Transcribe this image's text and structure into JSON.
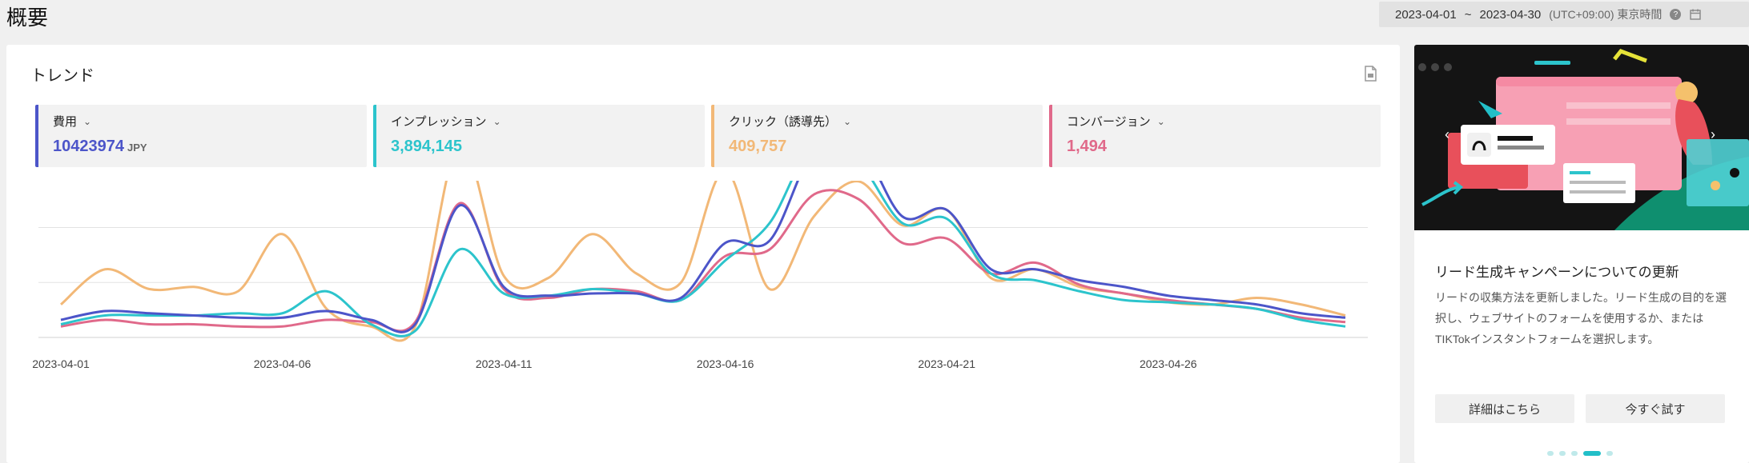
{
  "page": {
    "title": "概要"
  },
  "date_range": {
    "start": "2023-04-01",
    "separator": "~",
    "end": "2023-04-30",
    "timezone": "(UTC+09:00) 東京時間"
  },
  "trend": {
    "title": "トレンド",
    "metrics": [
      {
        "label": "費用",
        "value": "10423974",
        "unit": "JPY",
        "color": "#4c55c9"
      },
      {
        "label": "インプレッション",
        "value": "3,894,145",
        "unit": "",
        "color": "#2cc4cc"
      },
      {
        "label": "クリック（誘導先）",
        "value": "409,757",
        "unit": "",
        "color": "#f2b877"
      },
      {
        "label": "コンバージョン",
        "value": "1,494",
        "unit": "",
        "color": "#e0698a"
      }
    ]
  },
  "chart_data": {
    "type": "line",
    "x": [
      "2023-04-01",
      "2023-04-02",
      "2023-04-03",
      "2023-04-04",
      "2023-04-05",
      "2023-04-06",
      "2023-04-07",
      "2023-04-08",
      "2023-04-09",
      "2023-04-10",
      "2023-04-11",
      "2023-04-12",
      "2023-04-13",
      "2023-04-14",
      "2023-04-15",
      "2023-04-16",
      "2023-04-17",
      "2023-04-18",
      "2023-04-19",
      "2023-04-20",
      "2023-04-21",
      "2023-04-22",
      "2023-04-23",
      "2023-04-24",
      "2023-04-25",
      "2023-04-26",
      "2023-04-27",
      "2023-04-28",
      "2023-04-29",
      "2023-04-30"
    ],
    "x_tick_labels": [
      "2023-04-01",
      "2023-04-06",
      "2023-04-11",
      "2023-04-16",
      "2023-04-21",
      "2023-04-26"
    ],
    "ylim": [
      0,
      100
    ],
    "grid": true,
    "series": [
      {
        "color": "#4c55c9",
        "values": [
          8,
          12,
          11,
          10,
          9,
          9,
          12,
          8,
          6,
          60,
          23,
          19,
          20,
          20,
          18,
          43,
          44,
          85,
          88,
          55,
          58,
          31,
          31,
          26,
          23,
          19,
          17,
          15,
          11,
          9
        ]
      },
      {
        "color": "#2cc4cc",
        "values": [
          6,
          10,
          10,
          10,
          11,
          11,
          21,
          6,
          3,
          40,
          20,
          19,
          22,
          20,
          17,
          35,
          52,
          88,
          80,
          52,
          54,
          29,
          26,
          21,
          17,
          16,
          15,
          13,
          8,
          5
        ]
      },
      {
        "color": "#f2b877",
        "values": [
          15,
          31,
          22,
          23,
          21,
          47,
          13,
          5,
          5,
          88,
          28,
          27,
          47,
          29,
          25,
          76,
          22,
          55,
          71,
          51,
          58,
          27,
          31,
          23,
          20,
          16,
          15,
          18,
          15,
          10
        ]
      },
      {
        "color": "#e0698a",
        "values": [
          5,
          8,
          6,
          6,
          5,
          5,
          8,
          7,
          7,
          61,
          22,
          18,
          22,
          21,
          17,
          37,
          40,
          65,
          63,
          43,
          45,
          29,
          34,
          24,
          20,
          17,
          15,
          13,
          9,
          7
        ]
      }
    ]
  },
  "promo": {
    "title": "リード生成キャンペーンについての更新",
    "description": "リードの収集方法を更新しました。リード生成の目的を選択し、ウェブサイトのフォームを使用するか、またはTIKTokインスタントフォームを選択します。",
    "learn_more": "詳細はこちら",
    "try_now": "今すぐ試す"
  }
}
